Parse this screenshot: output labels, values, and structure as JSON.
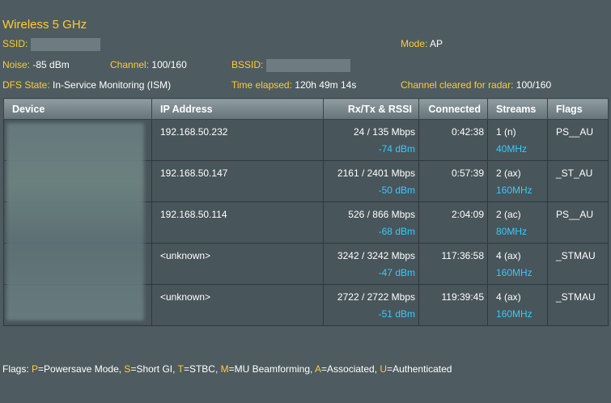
{
  "title": "Wireless 5 GHz",
  "info": {
    "ssid_label": "SSID:",
    "mode_label": "Mode:",
    "mode_value": "AP",
    "noise_label": "Noise:",
    "noise_value": "-85 dBm",
    "channel_label": "Channel:",
    "channel_value": "100/160",
    "bssid_label": "BSSID:",
    "dfs_label": "DFS State:",
    "dfs_value": "In-Service Monitoring (ISM)",
    "elapsed_label": "Time elapsed:",
    "elapsed_value": "120h 49m 14s",
    "radar_label": "Channel cleared for radar:",
    "radar_value": "100/160"
  },
  "table": {
    "headers": [
      "Device",
      "IP Address",
      "Rx/Tx & RSSI",
      "Connected",
      "Streams",
      "Flags"
    ],
    "rows": [
      {
        "ip": "192.168.50.232",
        "rate": "24 / 135 Mbps",
        "rssi": "-74 dBm",
        "connected": "0:42:38",
        "streams": "1 (n)",
        "bw": "40MHz",
        "flags": "PS__AU"
      },
      {
        "ip": "192.168.50.147",
        "rate": "2161 / 2401 Mbps",
        "rssi": "-50 dBm",
        "connected": "0:57:39",
        "streams": "2 (ax)",
        "bw": "160MHz",
        "flags": "_ST_AU"
      },
      {
        "ip": "192.168.50.114",
        "rate": "526 / 866 Mbps",
        "rssi": "-68 dBm",
        "connected": "2:04:09",
        "streams": "2 (ac)",
        "bw": "80MHz",
        "flags": "PS__AU"
      },
      {
        "ip": "<unknown>",
        "rate": "3242 / 3242 Mbps",
        "rssi": "-47 dBm",
        "connected": "117:36:58",
        "streams": "4 (ax)",
        "bw": "160MHz",
        "flags": "_STMAU"
      },
      {
        "ip": "<unknown>",
        "rate": "2722 / 2722 Mbps",
        "rssi": "-51 dBm",
        "connected": "119:39:45",
        "streams": "4 (ax)",
        "bw": "160MHz",
        "flags": "_STMAU"
      }
    ]
  },
  "legend": {
    "prefix": "Flags: ",
    "items": [
      {
        "key": "P",
        "text": "=Powersave Mode, "
      },
      {
        "key": "S",
        "text": "=Short GI, "
      },
      {
        "key": "T",
        "text": "=STBC, "
      },
      {
        "key": "M",
        "text": "=MU Beamforming, "
      },
      {
        "key": "A",
        "text": "=Associated, "
      },
      {
        "key": "U",
        "text": "=Authenticated"
      }
    ]
  },
  "colors": {
    "background": "#4e5b60",
    "label": "#ffcc33",
    "rssi": "#33ccff"
  }
}
